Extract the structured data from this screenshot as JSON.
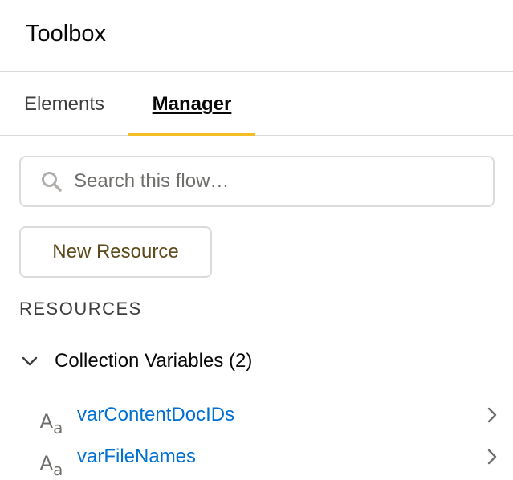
{
  "header": {
    "title": "Toolbox"
  },
  "tabs": [
    {
      "label": "Elements",
      "active": false
    },
    {
      "label": "Manager",
      "active": true
    }
  ],
  "search": {
    "placeholder": "Search this flow…",
    "value": ""
  },
  "new_resource_button": {
    "label": "New Resource"
  },
  "resources": {
    "heading": "RESOURCES",
    "group": {
      "label": "Collection Variables (2)",
      "expanded": true,
      "items": [
        {
          "icon": "text-type-icon",
          "type_glyph": "A",
          "type_glyph_sub": "a",
          "name": "varContentDocIDs"
        },
        {
          "icon": "text-type-icon",
          "type_glyph": "A",
          "type_glyph_sub": "a",
          "name": "varFileNames"
        }
      ]
    }
  },
  "colors": {
    "active_tab_indicator": "#f4bc25",
    "link": "#0070d2",
    "border": "#dddbda",
    "button_text": "#5c4a1a"
  }
}
